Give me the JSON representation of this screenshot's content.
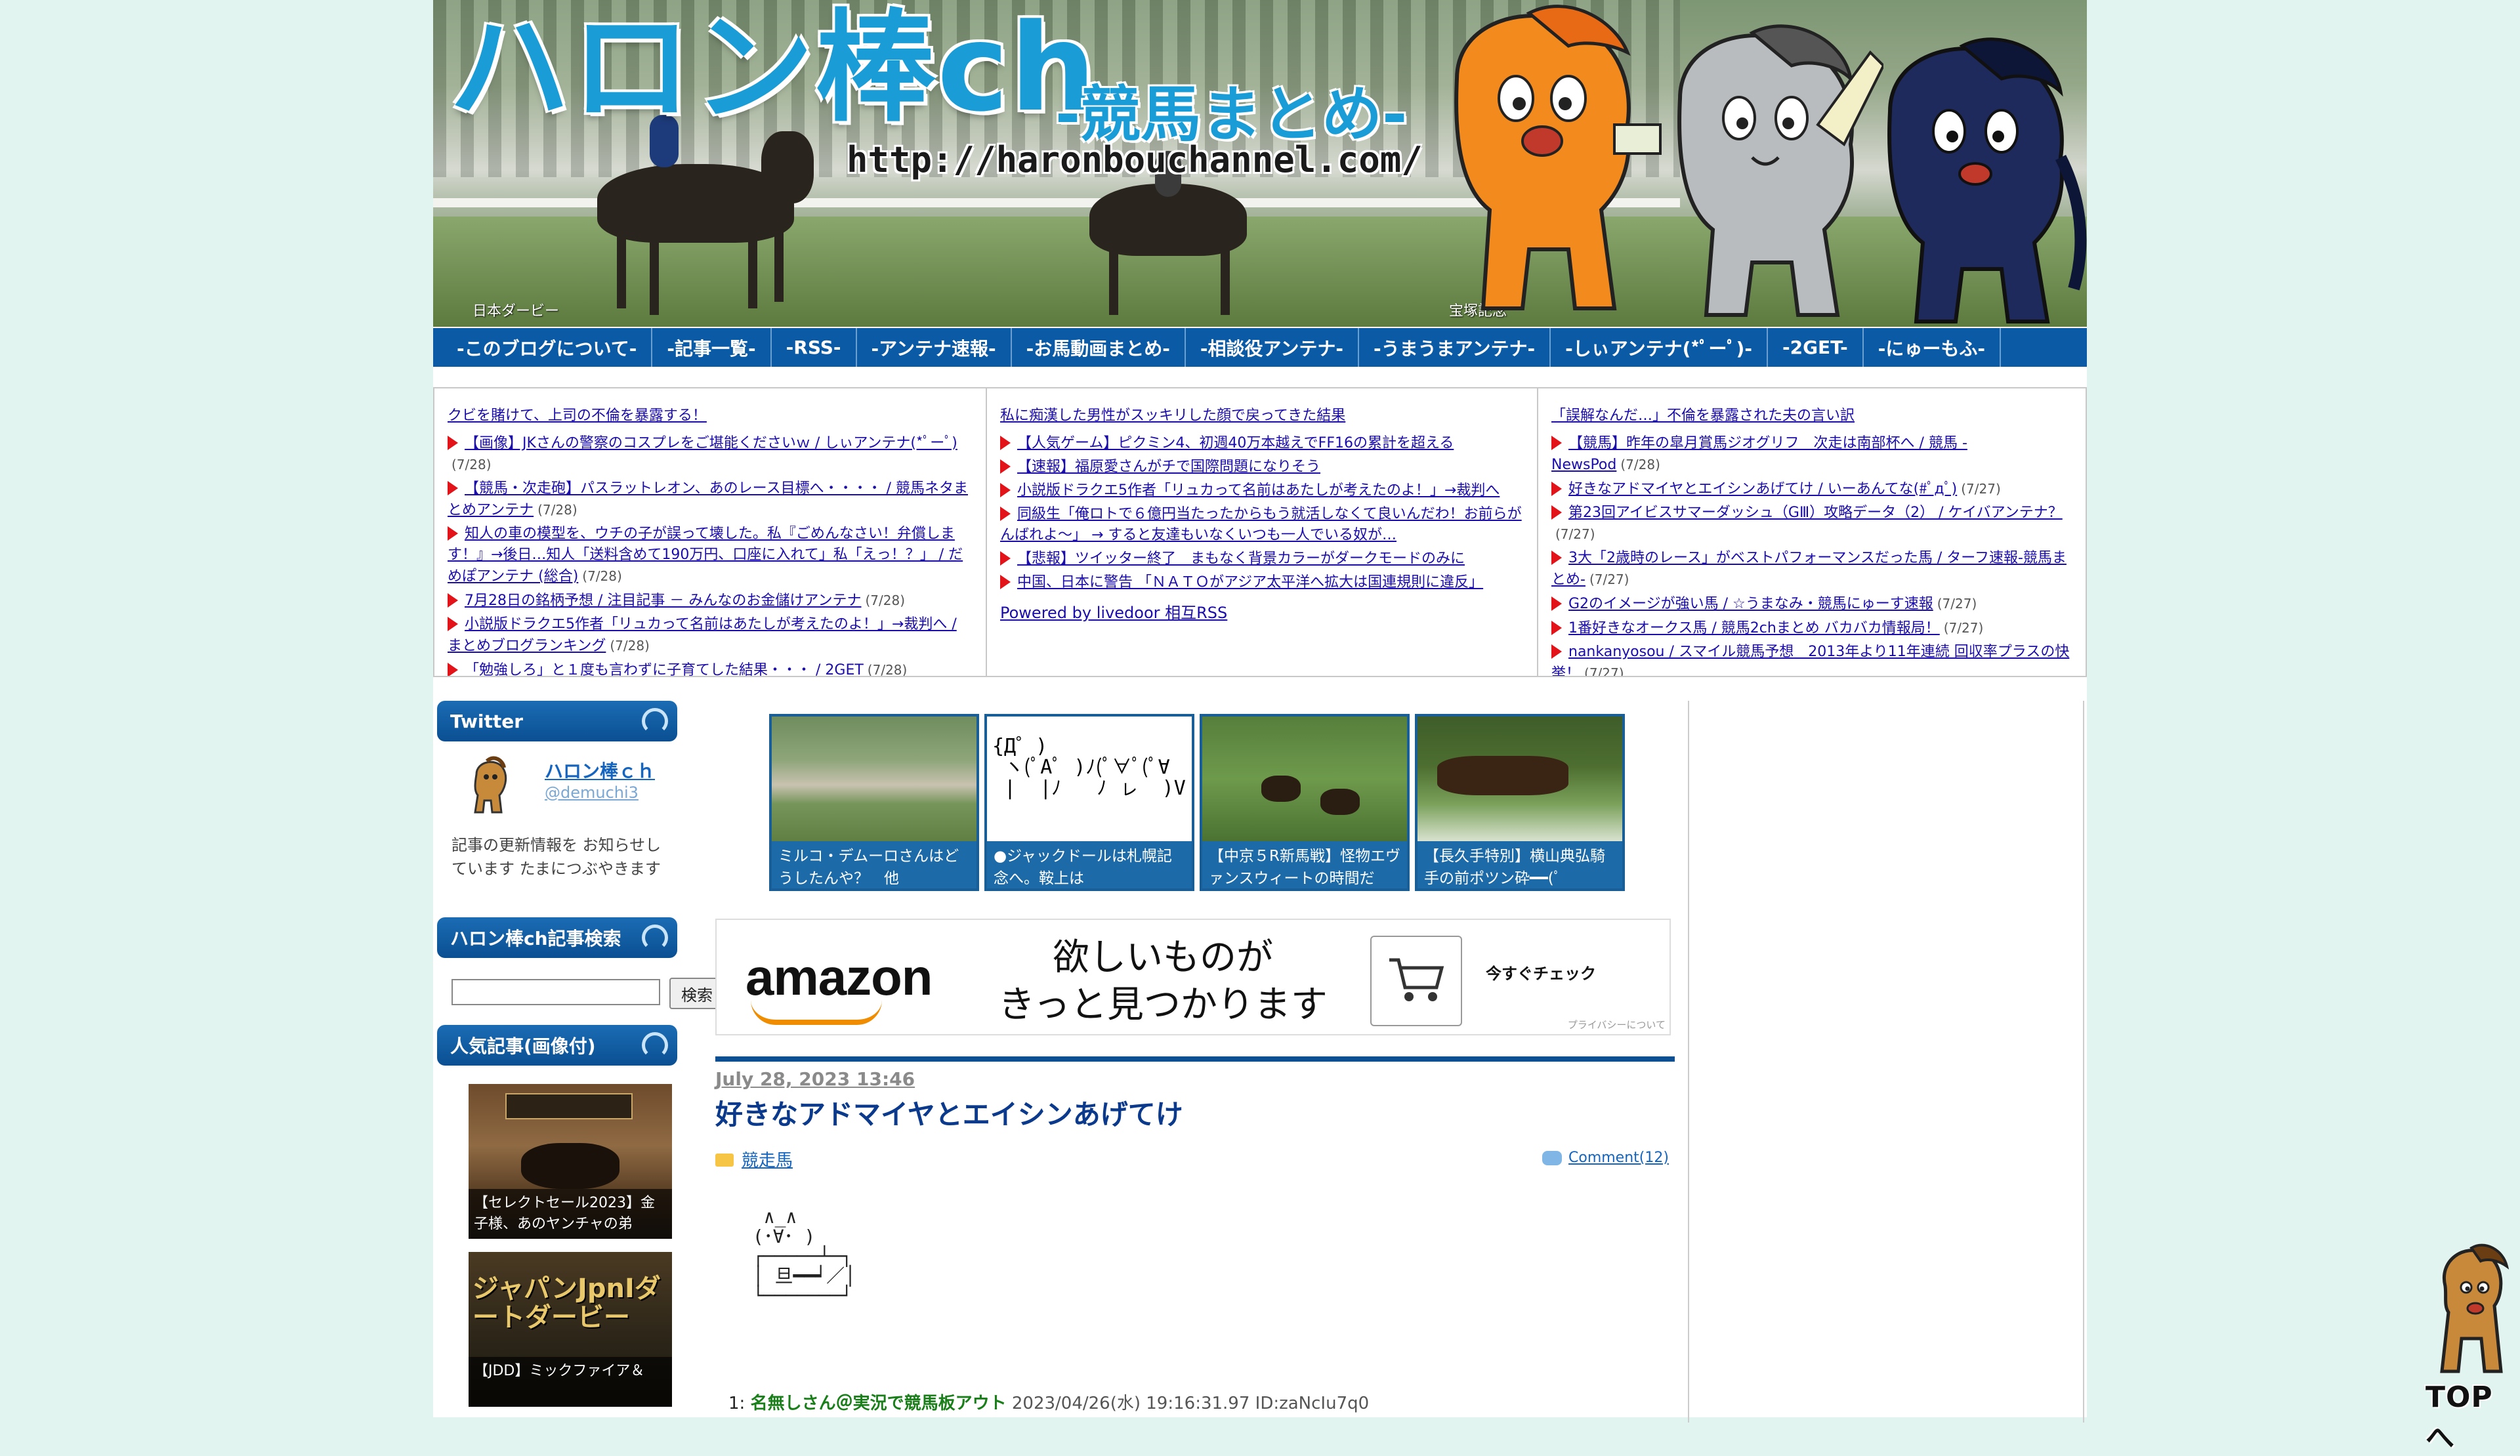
{
  "header": {
    "title": "ハロン棒ch",
    "subtitle": "-競馬まとめ-",
    "url": "http://haronbouchannel.com/",
    "caption_left": "日本ダービー",
    "caption_right": "宝塚記念"
  },
  "nav": {
    "items": [
      "-このブログについて-",
      "-記事一覧-",
      "-RSS-",
      "-アンテナ速報-",
      "-お馬動画まとめ-",
      "-相談役アンテナ-",
      "-うまうまアンテナ-",
      "-しぃアンテナ(*ﾟーﾟ)-",
      "-2GET-",
      "-にゅーもふ-"
    ]
  },
  "antenna": {
    "col1": {
      "head": "クビを賭けて、上司の不倫を暴露する！",
      "items": [
        {
          "text": "【画像】JKさんの警察のコスプレをご堪能くださいｗ / しぃアンテナ(*ﾟーﾟ)",
          "date": "(7/28)"
        },
        {
          "text": "【競馬・次走砲】パスラットレオン、あのレース目標へ・・・・ / 競馬ネタまとめアンテナ",
          "date": "(7/28)"
        },
        {
          "text": "知人の車の模型を、ウチの子が誤って壊した。私『ごめんなさい！弁償します！』→後日…知人「送料含めて190万円、口座に入れて」私「えっ！？」 / だめぽアンテナ (総合)",
          "date": "(7/28)"
        },
        {
          "text": "7月28日の銘柄予想 / 注目記事 － みんなのお金儲けアンテナ",
          "date": "(7/28)"
        },
        {
          "text": "小説版ドラクエ5作者「リュカって名前はあたしが考えたのよ！」→裁判へ / まとめブログランキング",
          "date": "(7/28)"
        },
        {
          "text": "「勉強しろ」と１度も言わずに子育てした結果・・・ / 2GET",
          "date": "(7/28)"
        }
      ]
    },
    "col2": {
      "head": "私に痴漢した男性がスッキリした顔で戻ってきた結果",
      "items": [
        {
          "text": "【人気ゲーム】ピクミン4、初週40万本越えでFF16の累計を超える"
        },
        {
          "text": "【速報】福原愛さんがチで国際問題になりそう"
        },
        {
          "text": "小説版ドラクエ5作者「リュカって名前はあたしが考えたのよ！」→裁判へ"
        },
        {
          "text": "同級生「俺ロトで６億円当たったからもう就活しなくて良いんだわ！お前らがんばれよ～」 → すると友達もいなくいつも一人でいる奴が…"
        },
        {
          "text": "【悲報】ツイッター終了　まもなく背景カラーがダークモードのみに"
        },
        {
          "text": "中国、日本に警告 「ＮＡＴＯがアジア太平洋へ拡大は国連規則に違反」"
        }
      ],
      "powered": "Powered by livedoor 相互RSS"
    },
    "col3": {
      "head": "「誤解なんだ…」不倫を暴露された夫の言い訳",
      "items": [
        {
          "text": "【競馬】昨年の皐月賞馬ジオグリフ　次走は南部杯へ / 競馬 - NewsPod",
          "date": "(7/28)"
        },
        {
          "text": "好きなアドマイヤとエイシンあげてけ / いーあんてな(#ﾟдﾟ)",
          "date": "(7/27)"
        },
        {
          "text": "第23回アイビスサマーダッシュ（GⅢ）攻略データ（2） / ケイバアンテナ？",
          "date": "(7/27)"
        },
        {
          "text": "3大「2歳時のレース」がベストパフォーマンスだった馬 / ターフ速報-競馬まとめ-",
          "date": "(7/27)"
        },
        {
          "text": "G2のイメージが強い馬 / ☆うまなみ・競馬にゅーす速報",
          "date": "(7/27)"
        },
        {
          "text": "1番好きなオークス馬 / 競馬2chまとめ バカバカ情報局！",
          "date": "(7/27)"
        },
        {
          "text": "nankanyosou / スマイル競馬予想　2013年より11年連続 回収率プラスの快挙！",
          "date": "(7/27)"
        }
      ]
    }
  },
  "sidebar": {
    "twitter": {
      "head": "Twitter",
      "name": "ハロン棒ｃｈ",
      "handle": "@demuchi3",
      "desc": "記事の更新情報を お知らせしています たまにつぶやきます"
    },
    "search": {
      "head": "ハロン棒ch記事検索",
      "button": "検索",
      "value": ""
    },
    "popular": {
      "head": "人気記事(画像付)",
      "items": [
        {
          "caption": "【セレクトセール2023】金子様、あのヤンチャの弟"
        },
        {
          "caption": "【JDD】ミックファイア＆"
        }
      ],
      "img2_text": "ジャパンJpnⅠダートダービー"
    }
  },
  "thumbs": [
    {
      "caption": "ミルコ・デムーロさんはどうしたんや？　他"
    },
    {
      "caption": "●ジャックドールは札幌記念へ。鞍上は",
      "aa": "{Д゜)\n ヽ(ﾟAﾟ )ﾉ(ﾟ∀ﾟ(ﾟ∀\n |  |ﾉ   ﾉ ㇾ  )V"
    },
    {
      "caption": "【中京５R新馬戦】怪物エヴァンスウィートの時間だ"
    },
    {
      "caption": "【長久手特別】横山典弘騎手の前ポツン砕━━(ﾟ"
    }
  ],
  "amazon": {
    "logo": "amazon",
    "tagline_1": "欲しいものが",
    "tagline_2": "きっと見つかります",
    "check": "今すぐチェック",
    "privacy": "プライバシーについて"
  },
  "entry": {
    "date": "July 28, 2023 13:46",
    "title": "好きなアドマイヤとエイシンあげてけ",
    "category": "競走馬",
    "comments": "Comment(12)",
    "aa": "  ∧_∧\n (･∀･ )\n ┌─────┴─┐\n │ 旦━━┙／│\n └───────┘",
    "res_num": "1:",
    "res_name": "名無しさん＠実況で競馬板アウト",
    "res_meta": "2023/04/26(水) 19:16:31.97 ID:zaNcIu7q0"
  },
  "to_top": {
    "label": "TOPへ"
  },
  "colors": {
    "nav": "#0a5aa6",
    "title": "#1a9cd6",
    "accent_red": "#e2141a",
    "background": "#e2f4ef"
  }
}
